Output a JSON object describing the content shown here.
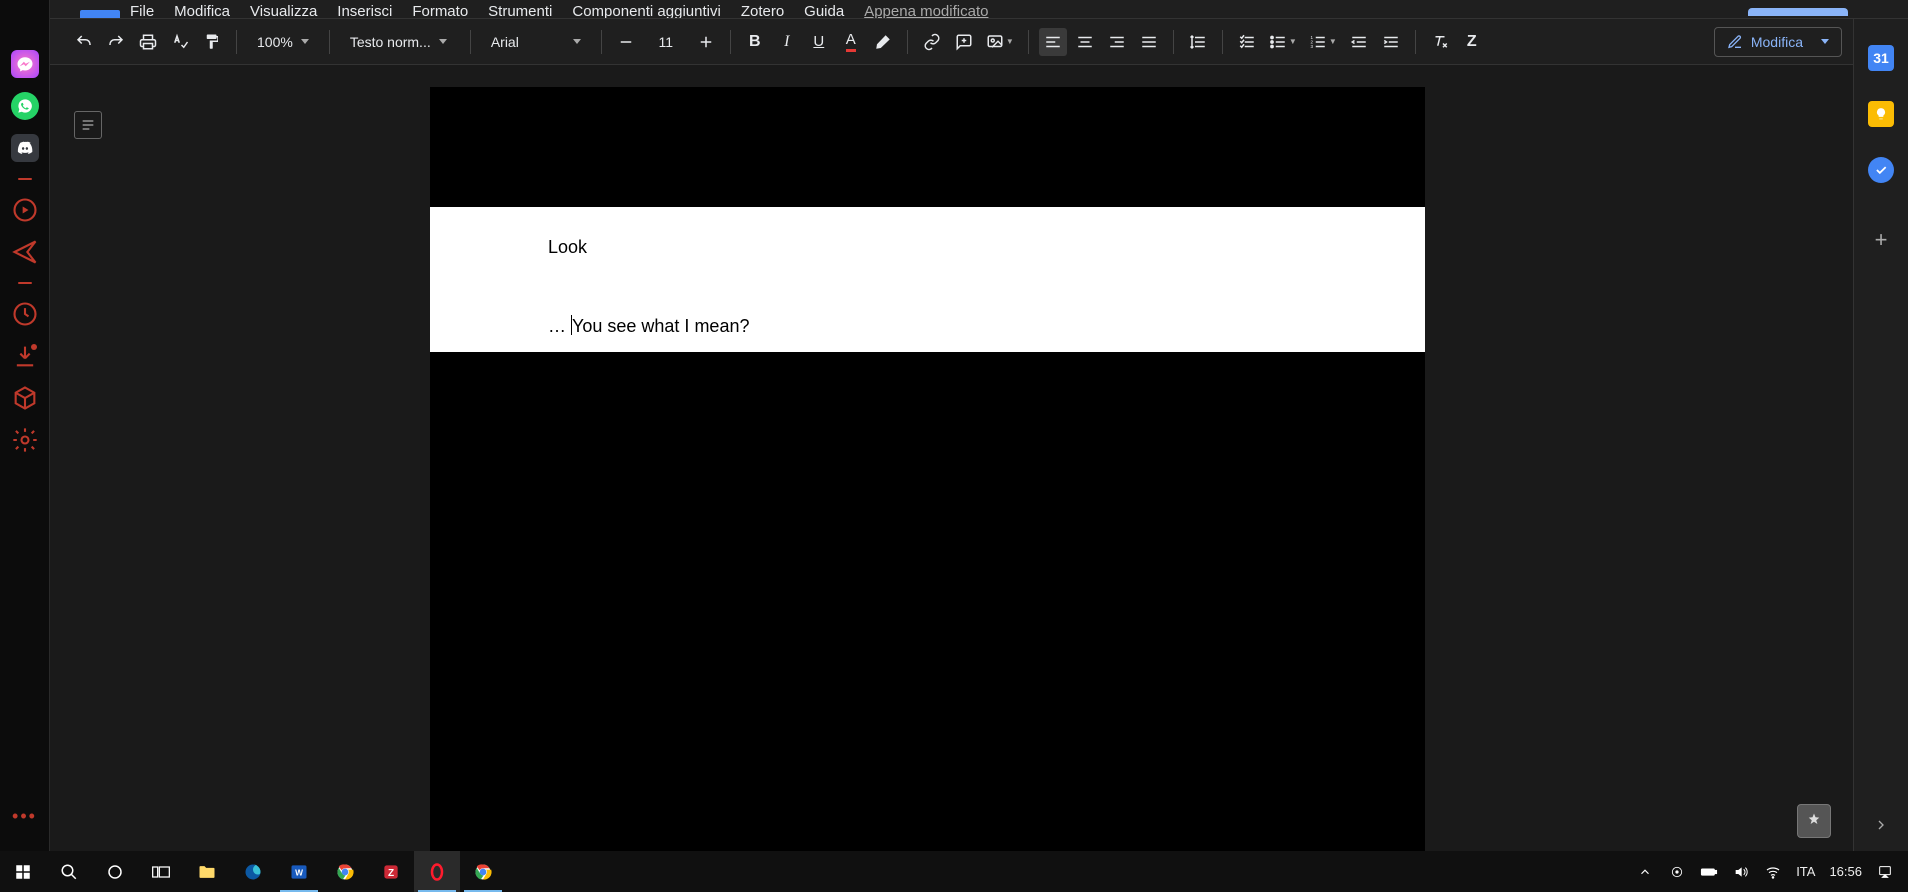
{
  "menubar": {
    "items": [
      "File",
      "Modifica",
      "Visualizza",
      "Inserisci",
      "Formato",
      "Strumenti",
      "Componenti aggiuntivi",
      "Zotero",
      "Guida"
    ],
    "last_edit": "Appena modificato"
  },
  "toolbar": {
    "zoom": "100%",
    "style": "Testo norm...",
    "font": "Arial",
    "font_size": "11",
    "editing_label": "Modifica"
  },
  "document": {
    "line1": "Look",
    "line2_prefix": "… ",
    "line2_rest": "You see what I mean?"
  },
  "launcher": {
    "messenger": "Messenger",
    "whatsapp": "WhatsApp",
    "discord": "Discord"
  },
  "sidepanel": {
    "calendar_day": "31"
  },
  "taskbar": {
    "lang": "ITA",
    "clock": "16:56"
  }
}
